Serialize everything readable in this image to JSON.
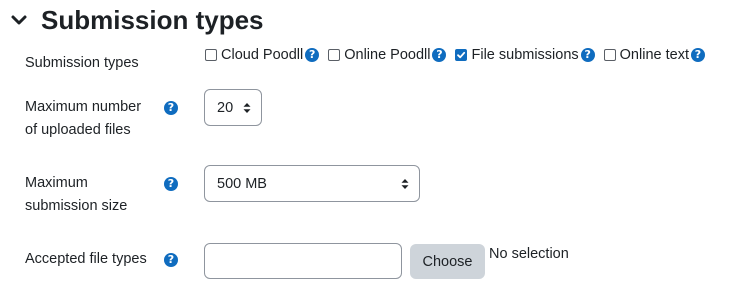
{
  "section": {
    "title": "Submission types",
    "icon": "chevron-down-icon"
  },
  "submission_types": {
    "label": "Submission types",
    "options": [
      {
        "label": "Cloud Poodll",
        "checked": false
      },
      {
        "label": "Online Poodll",
        "checked": false
      },
      {
        "label": "File submissions",
        "checked": true
      },
      {
        "label": "Online text",
        "checked": false
      }
    ]
  },
  "max_files": {
    "label_line1": "Maximum number",
    "label_line2": "of uploaded files",
    "value": "20"
  },
  "max_size": {
    "label_line1": "Maximum",
    "label_line2": "submission size",
    "value": "500 MB"
  },
  "file_types": {
    "label": "Accepted file types",
    "value": "",
    "choose_label": "Choose",
    "selection_text": "No selection"
  },
  "colors": {
    "accent": "#0f6cbf",
    "button_bg": "#ced4da",
    "border": "#8f959e"
  }
}
